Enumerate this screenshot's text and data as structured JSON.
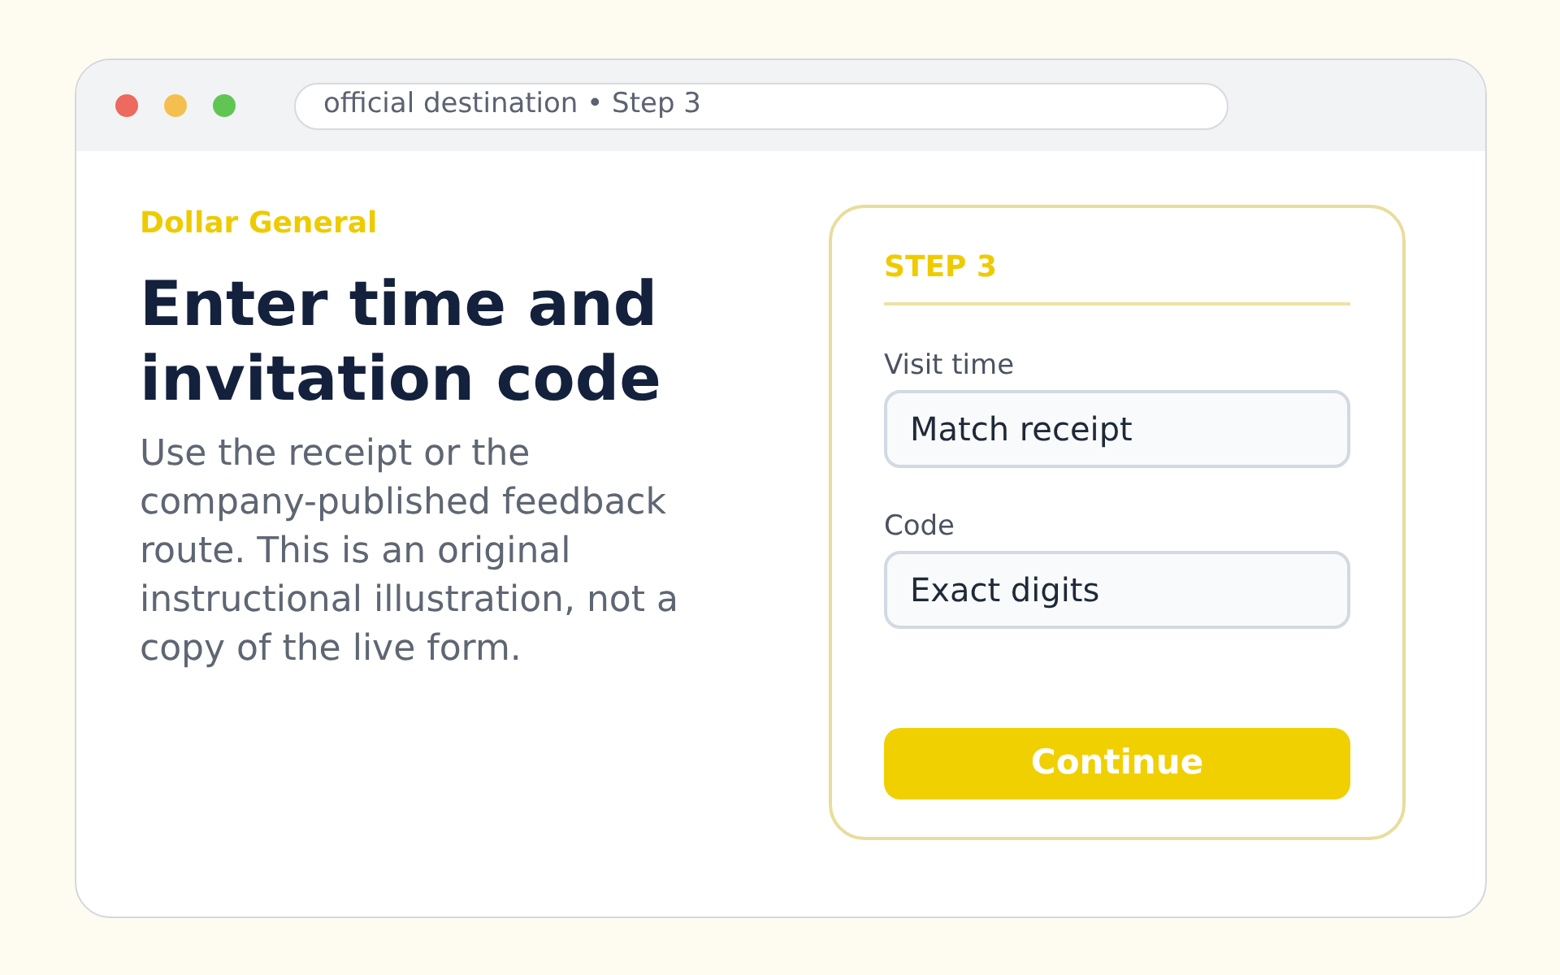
{
  "window": {
    "controls": [
      {
        "color": "#ec6a5e"
      },
      {
        "color": "#f4bf4f"
      },
      {
        "color": "#61c554"
      }
    ],
    "address_bar": "official destination • Step 3"
  },
  "intro": {
    "brand": "Dollar General",
    "title": "Enter time and invitation code",
    "description": "Use the receipt or the company-published feedback route. This is an original instructional illustration, not a copy of the live form."
  },
  "card": {
    "step_label": "STEP 3",
    "fields": [
      {
        "label": "Visit time",
        "value": "Match receipt"
      },
      {
        "label": "Code",
        "value": "Exact digits"
      }
    ],
    "button": "Continue"
  }
}
